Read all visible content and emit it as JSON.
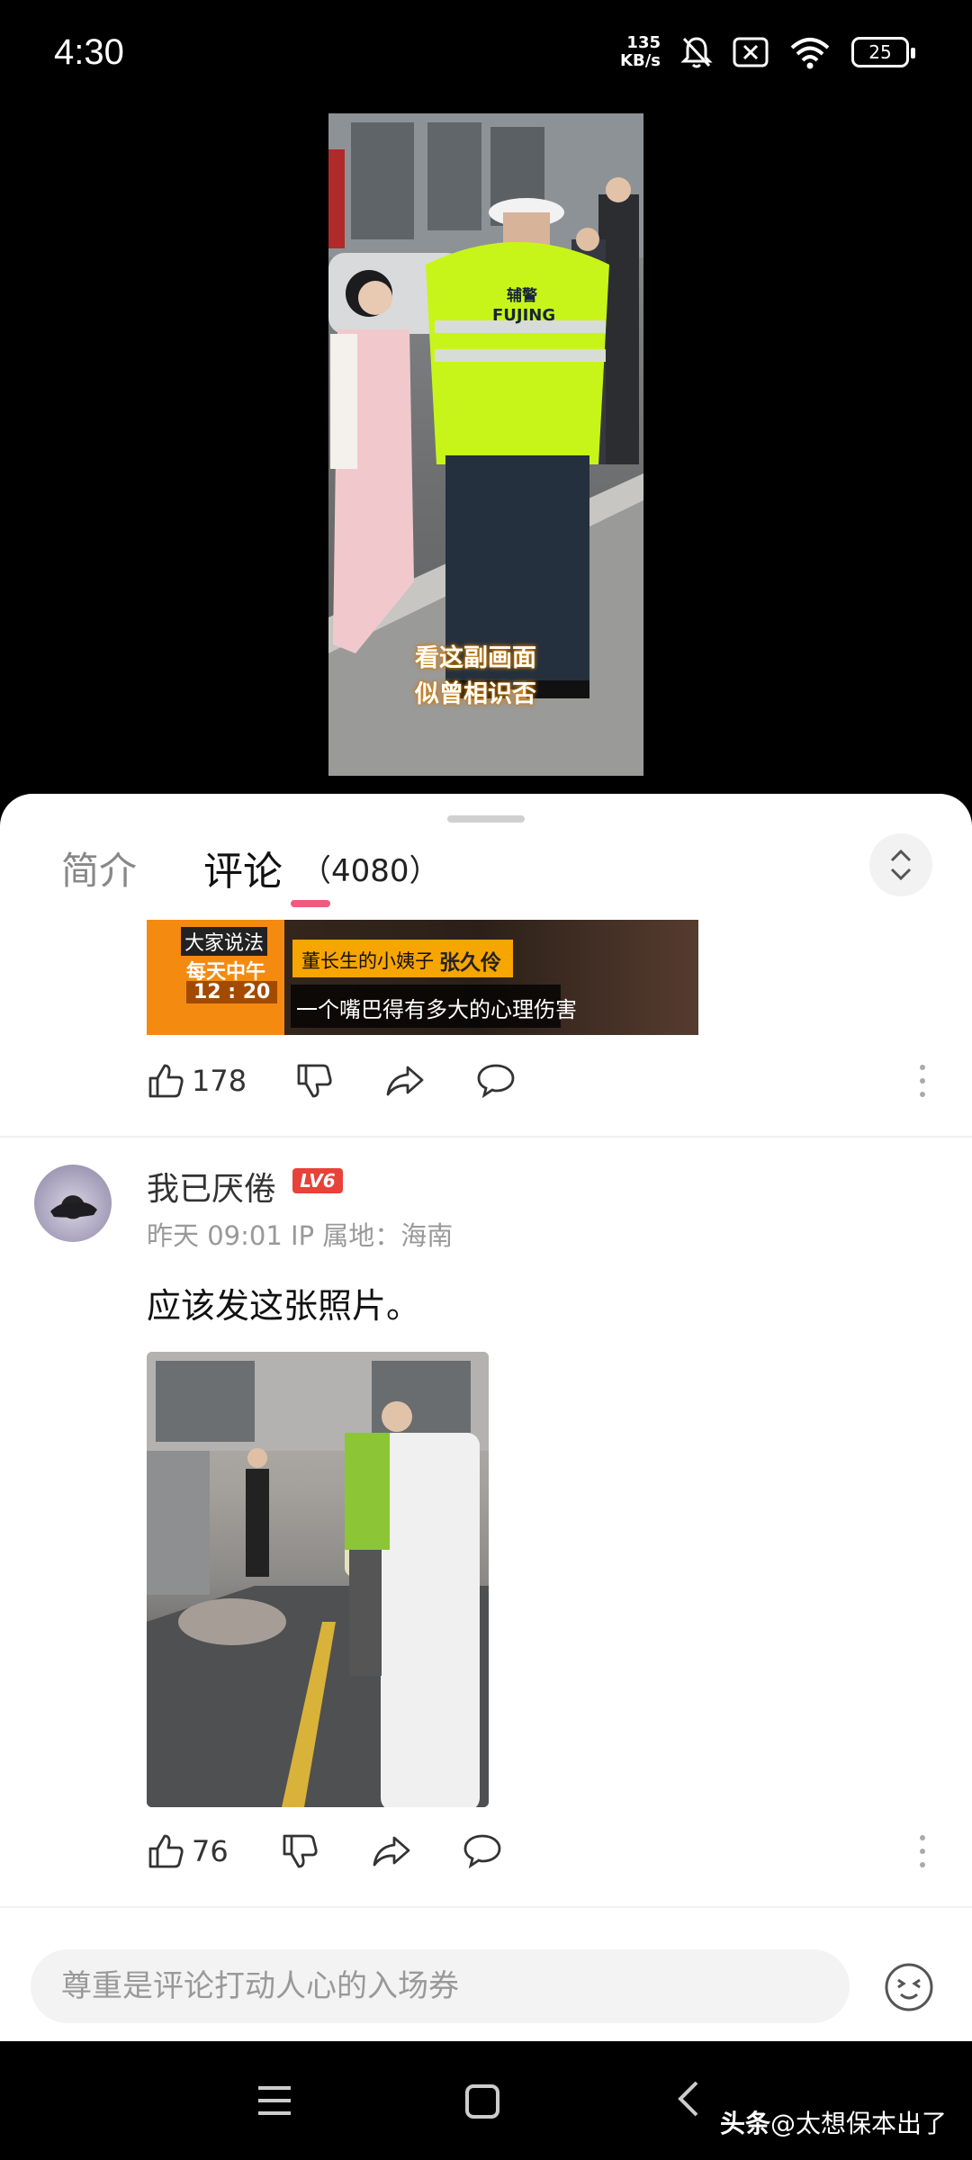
{
  "status_bar": {
    "time": "4:30",
    "net_speed_value": "135",
    "net_speed_unit": "KB/s",
    "battery": "25",
    "icons": [
      "mute-bell-icon",
      "sim-x-icon",
      "wifi-icon",
      "battery-icon"
    ]
  },
  "video": {
    "caption_line1": "看这副画面",
    "caption_line2": "似曾相识否",
    "vest_text1": "辅警",
    "vest_text2": "FUJING"
  },
  "tabs": {
    "intro": "简介",
    "comments": "评论",
    "comments_count": "（4080）"
  },
  "banner": {
    "brand_line1": "大家说法",
    "brand_line2": "每天中午",
    "brand_line3": "12 : 20",
    "tag": "董长生的小姨子",
    "name": "张久伶",
    "subtitle": "一个嘴巴得有多大的心理伤害"
  },
  "first_actions": {
    "like_count": "178"
  },
  "comment": {
    "username": "我已厌倦",
    "level": "LV6",
    "meta": "昨天 09:01 IP 属地：海南",
    "text": "应该发这张照片。",
    "like_count": "76"
  },
  "input": {
    "placeholder": "尊重是评论打动人心的入场券"
  },
  "watermark": {
    "prefix": "头条",
    "handle": "@太想保本出了"
  },
  "colors": {
    "accent_pink": "#f05a7e",
    "level_badge": "#e8423a"
  }
}
